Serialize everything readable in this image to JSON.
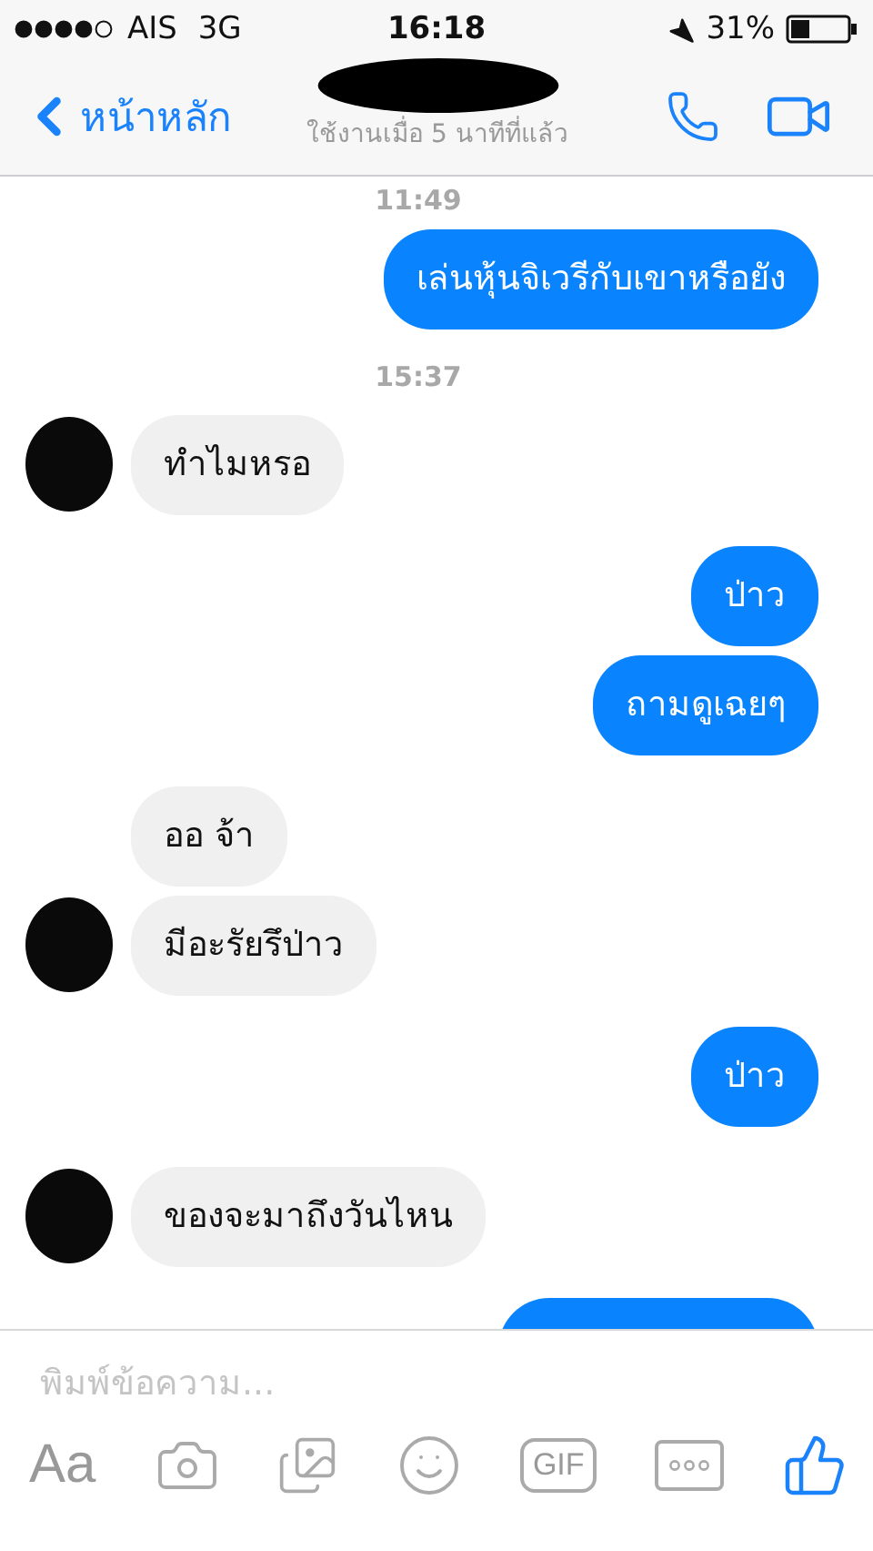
{
  "status_bar": {
    "carrier": "AIS",
    "network": "3G",
    "time": "16:18",
    "battery": "31%"
  },
  "nav": {
    "back": "หน้าหลัก",
    "subtitle": "ใช้งานเมื่อ 5 นาทีที่แล้ว"
  },
  "thread": [
    {
      "kind": "timestamp",
      "text": "11:49"
    },
    {
      "kind": "outgoing",
      "messages": [
        "เล่นหุ้นจิเวรีกับเขาหรือยัง"
      ]
    },
    {
      "kind": "timestamp",
      "text": "15:37"
    },
    {
      "kind": "incoming",
      "messages": [
        "ทำไมหรอ"
      ]
    },
    {
      "kind": "outgoing",
      "messages": [
        "ป่าว",
        "ถามดูเฉยๆ"
      ]
    },
    {
      "kind": "incoming",
      "messages": [
        "ออ จ้า",
        "มีอะรัยรึป่าว"
      ]
    },
    {
      "kind": "outgoing",
      "messages": [
        "ป่าว"
      ]
    },
    {
      "kind": "incoming",
      "messages": [
        "ของจะมาถึงวันไหน"
      ]
    },
    {
      "kind": "cut_outgoing"
    }
  ],
  "composer": {
    "placeholder": "พิมพ์ข้อความ...",
    "text_button": "Aa",
    "gif_button": "GIF"
  }
}
